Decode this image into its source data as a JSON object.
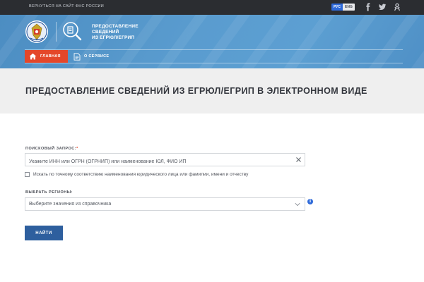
{
  "topbar": {
    "back_link": "Вернуться на сайт ФНС России",
    "lang_ru": "РУС",
    "lang_en": "ENG",
    "social_icons": [
      "facebook-icon",
      "twitter-icon",
      "odnoklassniki-icon"
    ]
  },
  "header": {
    "brand_line1": "Предоставление",
    "brand_line2": "сведений",
    "brand_line3": "из ЕГРЮЛ/ЕГРИП",
    "nav": [
      {
        "label": "Главная",
        "active": true,
        "icon": "home-icon"
      },
      {
        "label": "О сервисе",
        "active": false,
        "icon": "document-icon"
      }
    ]
  },
  "page": {
    "title": "Предоставление сведений из ЕГРЮЛ/ЕГРИП в электронном виде"
  },
  "form": {
    "search_label": "Поисковый запрос:",
    "search_required_mark": "*",
    "search_placeholder": "Укажите ИНН или ОГРН (ОГРНИП) или наименование ЮЛ, ФИО ИП",
    "search_value": "",
    "exact_match_label": "Искать по точному соответствию наименования юридического лица или фамилии, имени и отчеству",
    "exact_match_checked": false,
    "region_label": "Выбрать регионы:",
    "region_value": "Выберите значения из справочника",
    "info_glyph": "i",
    "submit_label": "Найти"
  },
  "colors": {
    "topbar": "#2b2d31",
    "header": "#5a9ccf",
    "nav_active": "#e4472a",
    "button": "#2e5f9e",
    "lang_active": "#2f6ad9"
  }
}
